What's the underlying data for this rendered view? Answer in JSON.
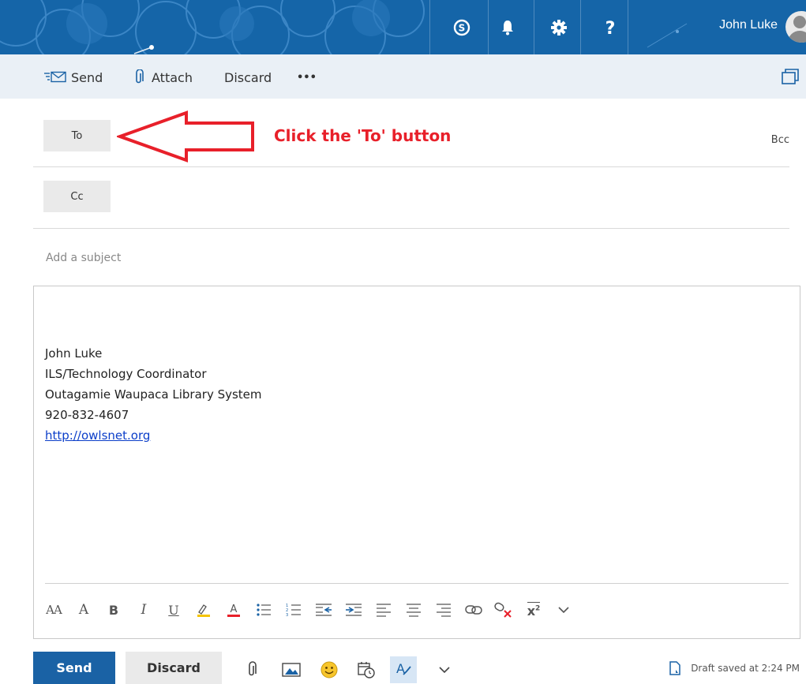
{
  "header": {
    "user_name": "John Luke",
    "icons": [
      "skype-icon",
      "bell-icon",
      "gear-icon",
      "help-icon"
    ]
  },
  "commandbar": {
    "send": "Send",
    "attach": "Attach",
    "discard": "Discard",
    "more": "•••"
  },
  "recipients": {
    "to_label": "To",
    "cc_label": "Cc",
    "bcc_label": "Bcc",
    "subject_placeholder": "Add a subject"
  },
  "annotation": {
    "text": "Click the 'To' button"
  },
  "body": {
    "signature": {
      "name": "John Luke",
      "title": "ILS/Technology Coordinator",
      "org": "Outagamie Waupaca Library System",
      "phone": "920-832-4607",
      "url": "http://owlsnet.org"
    }
  },
  "format_toolbar": {
    "font_size": "AA",
    "grow_font": "A",
    "bold": "B",
    "italic": "I",
    "underline": "U",
    "superscript": "x2"
  },
  "footer": {
    "send": "Send",
    "discard": "Discard",
    "draft_status": "Draft saved at 2:24 PM"
  },
  "colors": {
    "header": "#1565a8",
    "commandbar": "#eaf0f6",
    "send_button": "#1a62a5",
    "annotation": "#e8202a",
    "link": "#0b3ec9"
  }
}
